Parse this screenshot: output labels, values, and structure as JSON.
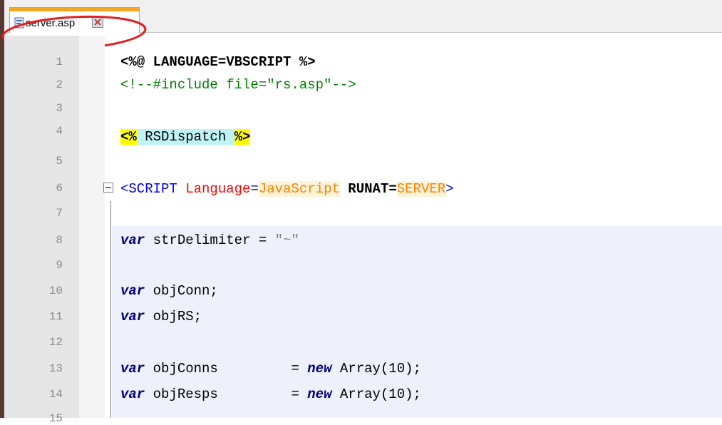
{
  "tab": {
    "filename": "server.asp"
  },
  "editor": {
    "line_numbers": [
      "1",
      "2",
      "3",
      "4",
      "5",
      "6",
      "7",
      "8",
      "9",
      "10",
      "11",
      "12",
      "13",
      "14",
      "15"
    ],
    "line1": "<%@ LANGUAGE=VBSCRIPT %>",
    "line2": "<!--#include file=\"rs.asp\"-->",
    "line4": {
      "open": "<%",
      "middle": " RSDispatch ",
      "close": "%>"
    },
    "line6": {
      "tag_open": "<SCRIPT",
      "attr1": " Language",
      "eq1": "=",
      "val1": "JavaScript",
      "attr2": " RUNAT",
      "eq2": "=",
      "val2": "SERVER",
      "tag_close": ">"
    },
    "line8": {
      "kw": "var",
      "rest": " strDelimiter = ",
      "str": "\"~\""
    },
    "line10": {
      "kw": "var",
      "rest": " objConn;"
    },
    "line11": {
      "kw": "var",
      "rest": " objRS;"
    },
    "line13": {
      "kw": "var",
      "rest": " objConns         = ",
      "kw2": "new",
      "tail": " Array(10);"
    },
    "line14": {
      "kw": "var",
      "rest": " objResps         = ",
      "kw2": "new",
      "tail": " Array(10);"
    }
  },
  "colors": {
    "tab_accent": "#f5a623",
    "annotation_ellipse": "#e02020",
    "keyword": "#000080",
    "tag": "#0000ff",
    "attribute": "#ff0000",
    "attribute_value": "#ff8000",
    "comment": "#008000",
    "asp_delimiter_highlight": "#ffff00",
    "asp_block_highlight": "#bff3f5",
    "script_block_bg": "#eef0fc"
  },
  "icons": {
    "file": "asp-file-icon",
    "close": "close-tab-icon",
    "fold": "fold-collapse-icon"
  }
}
